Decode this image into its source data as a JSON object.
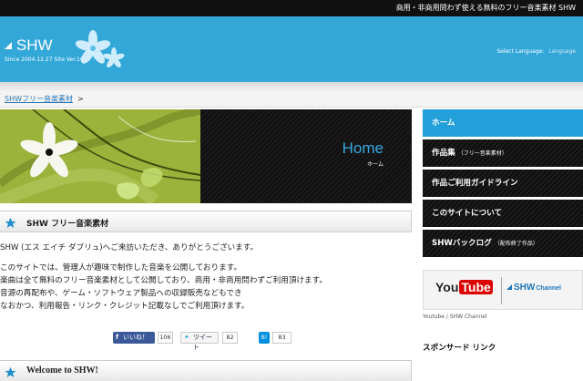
{
  "topbar": {
    "text": "商用・非商用問わず使える無料のフリー音楽素材 SHW"
  },
  "logo": {
    "name": "SHW",
    "since": "Since 2004.12.27   Site Ver.10"
  },
  "language": {
    "label": "Select Language:",
    "value": "Language"
  },
  "breadcrumb": {
    "link": "SHWフリー音楽素材",
    "separator": ">"
  },
  "hero": {
    "title": "Home",
    "subtitle": "ホーム"
  },
  "section1": {
    "title": "SHW フリー音楽素材"
  },
  "intro": [
    "SHW (エス エイチ ダブリュ)へご来訪いただき、ありがとうございます。",
    "このサイトでは、管理人が趣味で制作した音楽を公開しております。",
    "楽曲は全て無料のフリー音楽素材として公開しており、商用・非商用問わずご利用頂けます。",
    "音源の再配布や、ゲーム・ソフトウェア製品への収録販売などもでき",
    "なおかつ、利用報告・リンク・クレジット記載なしでご利用頂けます。"
  ],
  "social": {
    "facebook": {
      "label": "いいね！",
      "count": "106"
    },
    "twitter": {
      "label": "ツイート",
      "count": "82"
    },
    "hatena": {
      "label": "B!",
      "count": "83"
    }
  },
  "section2": {
    "title": "Welcome to SHW!"
  },
  "nav": [
    {
      "label": "ホーム",
      "sub": ""
    },
    {
      "label": "作品集",
      "sub": "（フリー音楽素材）"
    },
    {
      "label": "作品ご利用ガイドライン",
      "sub": ""
    },
    {
      "label": "このサイトについて",
      "sub": ""
    },
    {
      "label": "SHWバックログ",
      "sub": "（配布終了作品）"
    }
  ],
  "channels": {
    "youtube_a": "You",
    "youtube_b": "Tube",
    "shw": "SHW",
    "shw_small": "Channel",
    "caption": "Youtube / SHW Channel"
  },
  "sponsor": {
    "title": "スポンサード リンク"
  },
  "colors": {
    "accent": "#32a7d8",
    "nav_active": "#239fd9",
    "hero_green": "#9cb33b"
  }
}
